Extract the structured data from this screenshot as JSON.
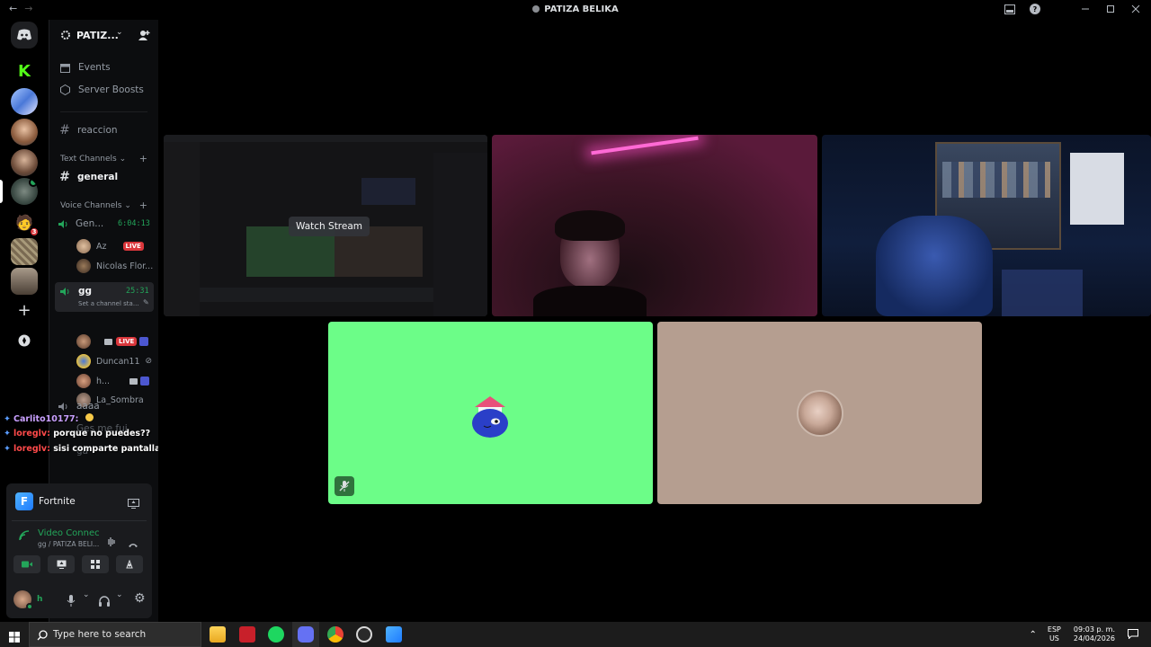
{
  "window": {
    "title": "PATIZA BELIKA"
  },
  "server": {
    "name": "PATIZ..."
  },
  "menu": {
    "events": "Events",
    "boosts": "Server Boosts"
  },
  "channels": {
    "reaccion": "reaccion",
    "text_category": "Text Channels",
    "general": "general",
    "voice_category": "Voice Channels",
    "gen_voice": {
      "name": "Gen...",
      "timer": "6:04:13"
    },
    "gen_users": [
      {
        "name": "Az",
        "badge": "LIVE"
      },
      {
        "name": "Nicolas Flor..."
      }
    ],
    "gg_voice": {
      "name": "gg",
      "timer": "25:31",
      "status": "Set a channel sta..."
    },
    "gg_users": [
      {
        "name": "",
        "badge": "LIVE"
      },
      {
        "name": "Duncan11"
      },
      {
        "name": "h..."
      },
      {
        "name": "La_Sombra"
      }
    ],
    "aaaa": "aaaa",
    "ges": "Ges me fui",
    "ga": "ga"
  },
  "chat_overlay": [
    {
      "user": "Carlito10177:",
      "msg": "",
      "user_color": "#c9a0ff"
    },
    {
      "user": "loreglv:",
      "msg": "porque no puedes??",
      "user_color": "#ff4a4a"
    },
    {
      "user": "loreglv:",
      "msg": "sisi comparte pantalla",
      "user_color": "#ff4a4a"
    }
  ],
  "panel": {
    "game": "Fortnite",
    "game_icon": "F",
    "connection": "Video Connec",
    "location": "gg / PATIZA BELI...",
    "user_initial": "h"
  },
  "stage": {
    "watch_stream": "Watch Stream"
  },
  "taskbar": {
    "search_placeholder": "Type here to search",
    "lang_top": "ESP",
    "lang_bottom": "US",
    "time": "09:03 p. m.",
    "date": "24/04/2026"
  },
  "colors": {
    "green_tile": "#6cfd88",
    "tan_tile": "#b59e90",
    "discord_blurple": "#5865f2",
    "voice_green": "#23a55a",
    "live_red": "#da373c"
  }
}
